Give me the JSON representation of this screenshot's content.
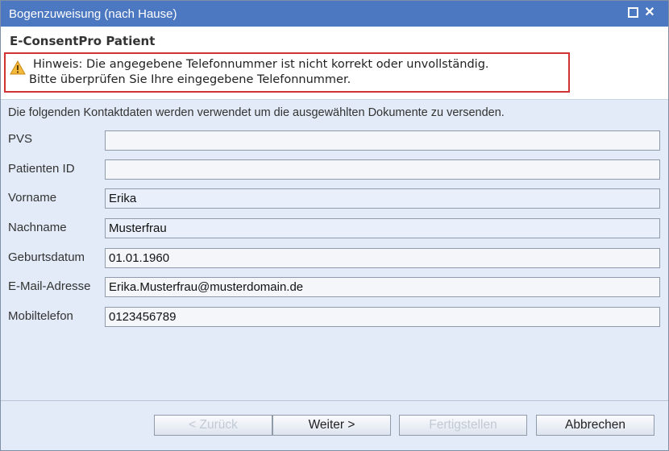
{
  "window": {
    "title": "Bogenzuweisung (nach Hause)"
  },
  "header": {
    "app_name": "E-ConsentPro Patient",
    "hint_line1": "Hinweis: Die angegebene Telefonnummer ist nicht korrekt oder unvollständig.",
    "hint_line2": "Bitte überprüfen Sie Ihre eingegebene Telefonnummer."
  },
  "form": {
    "intro": "Die folgenden Kontaktdaten werden verwendet um die ausgewählten Dokumente zu versenden.",
    "fields": [
      {
        "label": "PVS",
        "value": ""
      },
      {
        "label": "Patienten ID",
        "value": ""
      },
      {
        "label": "Vorname",
        "value": "Erika"
      },
      {
        "label": "Nachname",
        "value": "Musterfrau"
      },
      {
        "label": "Geburtsdatum",
        "value": "01.01.1960"
      },
      {
        "label": "E-Mail-Adresse",
        "value": "Erika.Musterfrau@musterdomain.de"
      },
      {
        "label": "Mobiltelefon",
        "value": "0123456789"
      }
    ]
  },
  "buttons": {
    "back": "< Zurück",
    "next": "Weiter >",
    "finish": "Fertigstellen",
    "cancel": "Abbrechen"
  },
  "colors": {
    "titlebar": "#4c78c2",
    "body_bg": "#e2ebf7",
    "hint_border": "#d33232"
  },
  "icons": {
    "warning": "warning-icon",
    "maximize": "maximize-icon",
    "close": "close-icon"
  }
}
